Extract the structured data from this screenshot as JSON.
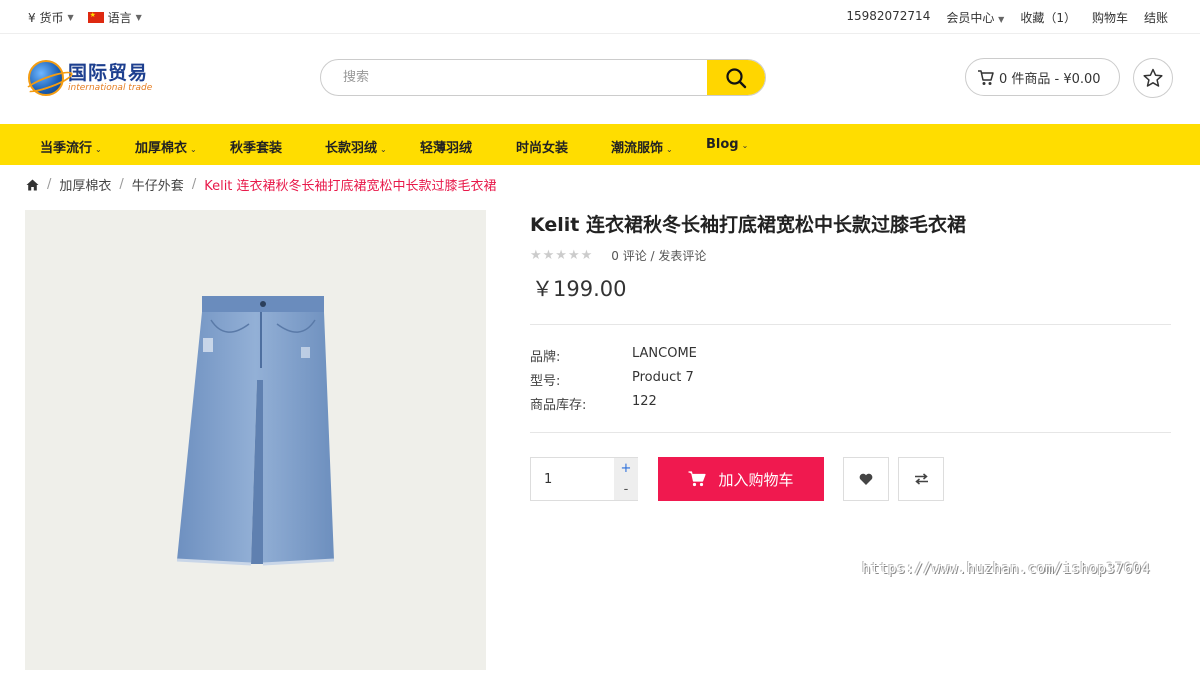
{
  "topbar": {
    "currency_label": "¥ 货币",
    "language_label": "语言",
    "phone": "15982072714",
    "member_center": "会员中心",
    "favorites": "收藏（1）",
    "cart": "购物车",
    "checkout": "结账"
  },
  "logo": {
    "cn": "国际贸易",
    "en": "international trade"
  },
  "search": {
    "placeholder": "搜索"
  },
  "header_cart": {
    "label": "0 件商品 - ¥0.00"
  },
  "nav": {
    "items": [
      {
        "label": "当季流行",
        "has_dropdown": true
      },
      {
        "label": "加厚棉衣",
        "has_dropdown": true
      },
      {
        "label": "秋季套装",
        "has_dropdown": false
      },
      {
        "label": "长款羽绒",
        "has_dropdown": true
      },
      {
        "label": "轻薄羽绒",
        "has_dropdown": false
      },
      {
        "label": "时尚女装",
        "has_dropdown": false
      },
      {
        "label": "潮流服饰",
        "has_dropdown": true
      },
      {
        "label": "Blog",
        "has_dropdown": true
      }
    ]
  },
  "breadcrumb": {
    "items": [
      "加厚棉衣",
      "牛仔外套"
    ],
    "current": "Kelit 连衣裙秋冬长袖打底裙宽松中长款过膝毛衣裙"
  },
  "product": {
    "title": "Kelit 连衣裙秋冬长袖打底裙宽松中长款过膝毛衣裙",
    "rating": 0,
    "reviews_link": "0 评论",
    "write_review_link": "发表评论",
    "price": "￥199.00",
    "specs": [
      {
        "label": "品牌:",
        "value": "LANCOME"
      },
      {
        "label": "型号:",
        "value": "Product 7"
      },
      {
        "label": "商品库存:",
        "value": "122"
      }
    ],
    "quantity": "1",
    "add_to_cart": "加入购物车",
    "image_alt_color": "#7fa0cc"
  },
  "watermark": "https://www.huzhan.com/ishop37604",
  "colors": {
    "accent_yellow": "#ffdd00",
    "cart_button": "#f0194f",
    "breadcrumb_current": "#e8194a"
  }
}
